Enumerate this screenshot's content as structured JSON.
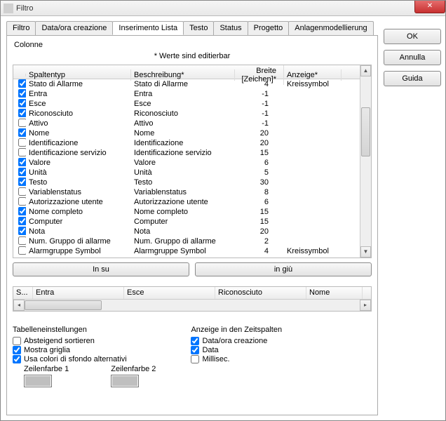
{
  "window": {
    "title": "Filtro"
  },
  "side_buttons": {
    "ok": "OK",
    "cancel": "Annulla",
    "help": "Guida"
  },
  "tabs": [
    {
      "label": "Filtro"
    },
    {
      "label": "Data/ora creazione"
    },
    {
      "label": "Inserimento Lista"
    },
    {
      "label": "Testo"
    },
    {
      "label": "Status"
    },
    {
      "label": "Progetto"
    },
    {
      "label": "Anlagenmodellierung"
    }
  ],
  "active_tab": 2,
  "group_label": "Colonne",
  "editable_hint": "* Werte sind editierbar",
  "columns": {
    "type": "Spaltentyp",
    "desc": "Beschreibung*",
    "width": "Breite [Zeichen]*",
    "display": "Anzeige*"
  },
  "rows": [
    {
      "checked": true,
      "type": "Stato di Allarme",
      "desc": "Stato di Allarme",
      "width": "4",
      "display": "Kreissymbol"
    },
    {
      "checked": true,
      "type": "Entra",
      "desc": "Entra",
      "width": "-1",
      "display": ""
    },
    {
      "checked": true,
      "type": "Esce",
      "desc": "Esce",
      "width": "-1",
      "display": ""
    },
    {
      "checked": true,
      "type": "Riconosciuto",
      "desc": "Riconosciuto",
      "width": "-1",
      "display": ""
    },
    {
      "checked": false,
      "type": "Attivo",
      "desc": "Attivo",
      "width": "-1",
      "display": ""
    },
    {
      "checked": true,
      "type": "Nome",
      "desc": "Nome",
      "width": "20",
      "display": ""
    },
    {
      "checked": false,
      "type": "Identificazione",
      "desc": "Identificazione",
      "width": "20",
      "display": ""
    },
    {
      "checked": false,
      "type": "Identificazione servizio",
      "desc": "Identificazione servizio",
      "width": "15",
      "display": ""
    },
    {
      "checked": true,
      "type": "Valore",
      "desc": "Valore",
      "width": "6",
      "display": ""
    },
    {
      "checked": true,
      "type": "Unità",
      "desc": "Unità",
      "width": "5",
      "display": ""
    },
    {
      "checked": true,
      "type": "Testo",
      "desc": "Testo",
      "width": "30",
      "display": ""
    },
    {
      "checked": false,
      "type": "Variablenstatus",
      "desc": "Variablenstatus",
      "width": "8",
      "display": ""
    },
    {
      "checked": false,
      "type": "Autorizzazione utente",
      "desc": "Autorizzazione utente",
      "width": "6",
      "display": ""
    },
    {
      "checked": true,
      "type": "Nome completo",
      "desc": "Nome completo",
      "width": "15",
      "display": ""
    },
    {
      "checked": true,
      "type": "Computer",
      "desc": "Computer",
      "width": "15",
      "display": ""
    },
    {
      "checked": true,
      "type": "Nota",
      "desc": "Nota",
      "width": "20",
      "display": ""
    },
    {
      "checked": false,
      "type": "Num. Gruppo di allarme",
      "desc": "Num. Gruppo di allarme",
      "width": "2",
      "display": ""
    },
    {
      "checked": false,
      "type": "Alarmgruppe Symbol",
      "desc": "Alarmgruppe Symbol",
      "width": "4",
      "display": "Kreissymbol"
    }
  ],
  "move": {
    "up": "In su",
    "down": "in giù"
  },
  "preview_cols": [
    "S...",
    "Entra",
    "Esce",
    "Riconosciuto",
    "Nome"
  ],
  "table_settings": {
    "title": "Tabelleneinstellungen",
    "sort_desc": {
      "label": "Absteigend sortieren",
      "checked": false
    },
    "show_grid": {
      "label": "Mostra griglia",
      "checked": true
    },
    "alt_colors": {
      "label": "Usa colori di sfondo alternativi",
      "checked": true
    },
    "color1_label": "Zeilenfarbe 1",
    "color2_label": "Zeilenfarbe 2",
    "color1": "#bfbfbf",
    "color2": "#bfbfbf"
  },
  "time_cols": {
    "title": "Anzeige in den Zeitspalten",
    "datetime": {
      "label": "Data/ora creazione",
      "checked": true
    },
    "date": {
      "label": "Data",
      "checked": true
    },
    "msec": {
      "label": "Millisec.",
      "checked": false
    }
  }
}
